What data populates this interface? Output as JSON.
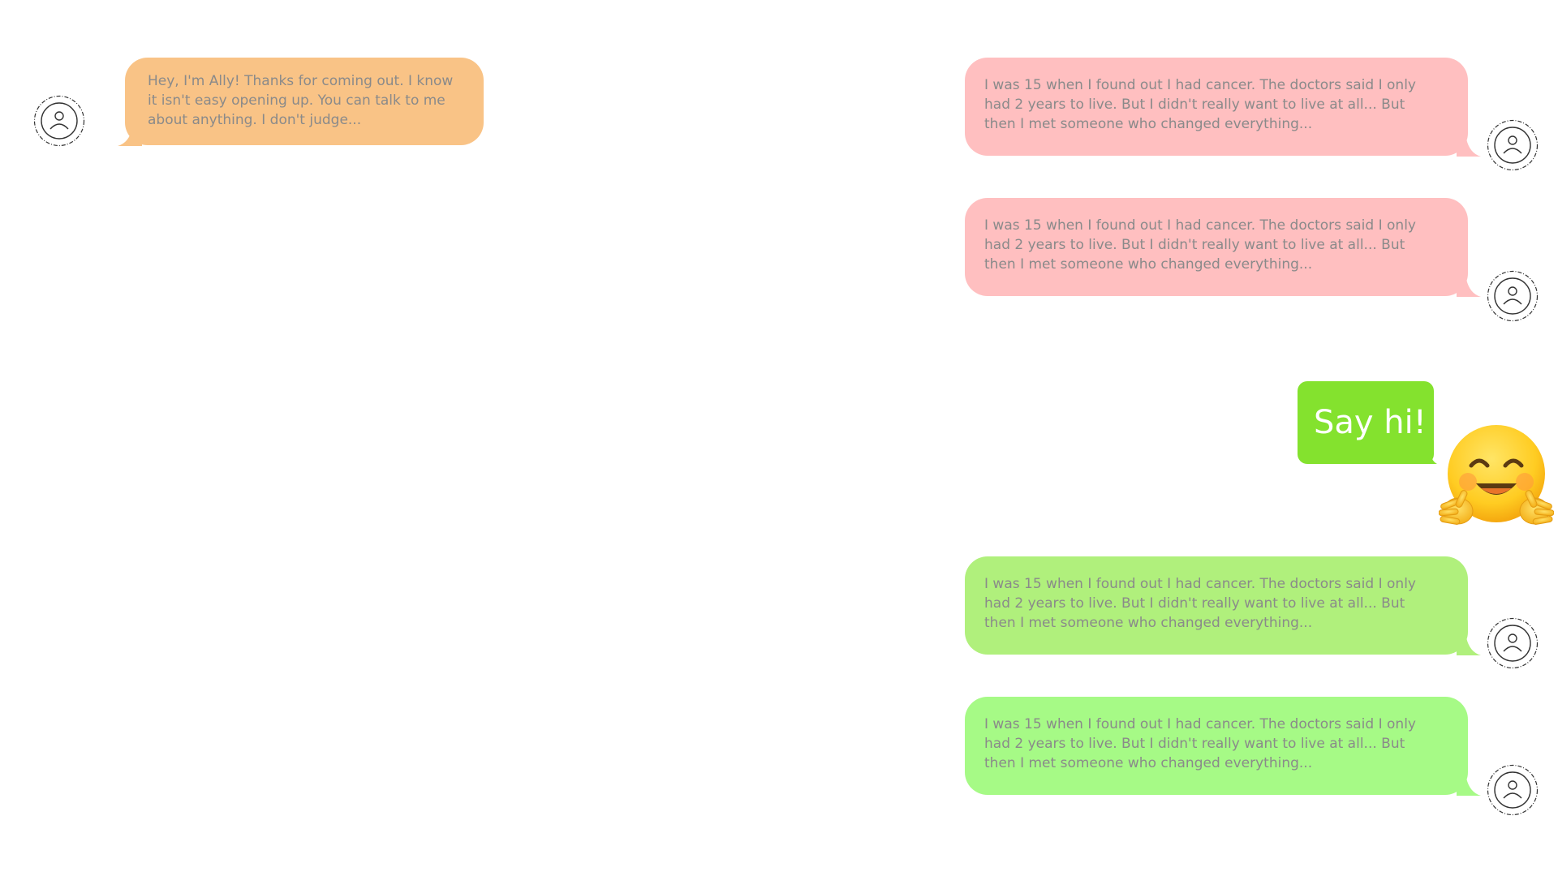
{
  "colors": {
    "left_bubble": "#f9c386",
    "pink_bubble": "#ffbfc0",
    "green_bubble_1": "#b0f07c",
    "green_bubble_2": "#a6fa86",
    "cta_bubble": "#84e22e",
    "bubble_text": "#8a8a8a",
    "cta_text": "#ffffff",
    "avatar_stroke": "#333333"
  },
  "chat": {
    "incoming": {
      "text": "Hey, I'm Ally! Thanks for coming out. I know it isn't easy opening up. You can talk to me about anything. I don't judge...",
      "avatar_icon": "user-avatar-icon"
    },
    "outgoing": [
      {
        "text": "I was 15 when I found out I had cancer. The doctors said I only had 2 years to live. But I didn't really want to live at all... But then I met someone who changed everything...",
        "color_key": "pink_bubble",
        "avatar_icon": "user-avatar-icon"
      },
      {
        "text": "I was 15 when I found out I had cancer. The doctors said I only had 2 years to live. But I didn't really want to live at all... But then I met someone who changed everything...",
        "color_key": "pink_bubble",
        "avatar_icon": "user-avatar-icon"
      },
      {
        "text": "I was 15 when I found out I had cancer. The doctors said I only had 2 years to live. But I didn't really want to live at all... But then I met someone who changed everything...",
        "color_key": "green_bubble_1",
        "avatar_icon": "user-avatar-icon"
      },
      {
        "text": "I was 15 when I found out I had cancer. The doctors said I only had 2 years to live. But I didn't really want to live at all... But then I met someone who changed everything...",
        "color_key": "green_bubble_2",
        "avatar_icon": "user-avatar-icon"
      }
    ],
    "cta": {
      "label": "Say hi!",
      "emoji_icon": "hugging-face-emoji-icon"
    }
  }
}
